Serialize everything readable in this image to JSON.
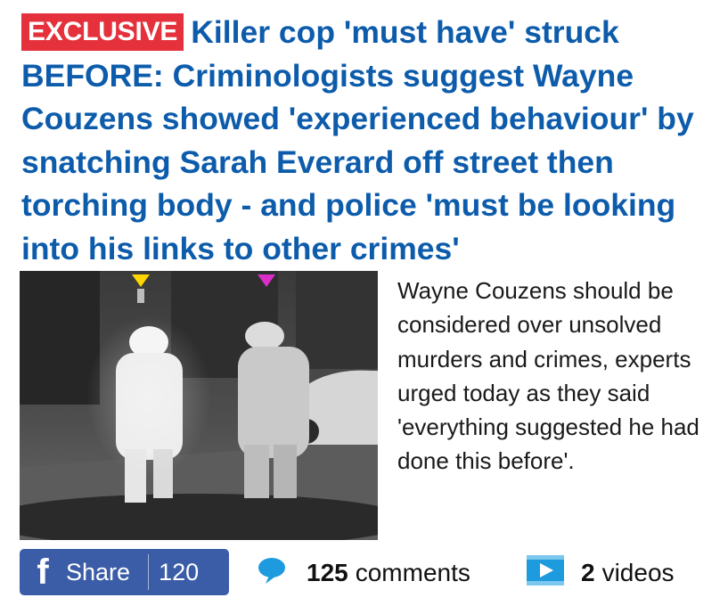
{
  "headline": {
    "badge": "EXCLUSIVE",
    "text": "Killer cop 'must have' struck BEFORE: Criminologists suggest Wayne Couzens showed 'experienced behaviour' by snatching Sarah Everard off street then torching body - and police 'must be looking into his links to other crimes'"
  },
  "summary": "Wayne Couzens should be considered over unsolved murders and crimes, experts urged today as they said 'everything suggested he had done this before'.",
  "share": {
    "label": "Share",
    "count": "120",
    "icon": "facebook-icon"
  },
  "comments": {
    "count": "125",
    "label": "comments",
    "icon": "speech-bubble-icon"
  },
  "videos": {
    "count": "2",
    "label": "videos",
    "icon": "video-play-icon"
  },
  "colors": {
    "headline": "#0d5cab",
    "badge": "#e4313c",
    "facebook": "#3b5da8",
    "comment_icon": "#1e9bde",
    "video_icon": "#1e9bde"
  }
}
